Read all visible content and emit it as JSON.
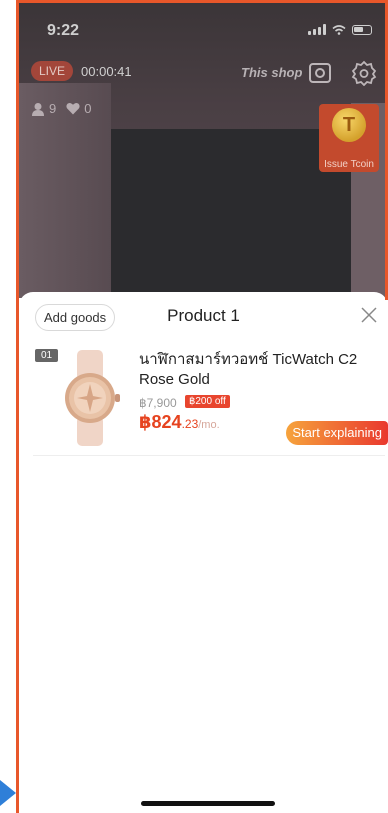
{
  "status_bar": {
    "time": "9:22"
  },
  "live": {
    "badge": "LIVE",
    "timer": "00:00:41",
    "shop_label": "This shop",
    "viewers": "9",
    "likes": "0"
  },
  "tcoin": {
    "symbol": "T",
    "label": "Issue Tcoin"
  },
  "sheet": {
    "add_goods_label": "Add goods",
    "title": "Product 1"
  },
  "products": [
    {
      "index": "01",
      "name": "นาฬิกาสมาร์ทวอทช์ TicWatch C2 Rose Gold",
      "original_price": "฿7,900",
      "discount": "฿200 off",
      "price_whole": "฿824",
      "price_decimal": ".23",
      "price_per": "/mo.",
      "action_label": "Start explaining"
    }
  ],
  "colors": {
    "accent": "#e6431f",
    "live_badge": "#a3463a",
    "frame": "#e8572a"
  }
}
